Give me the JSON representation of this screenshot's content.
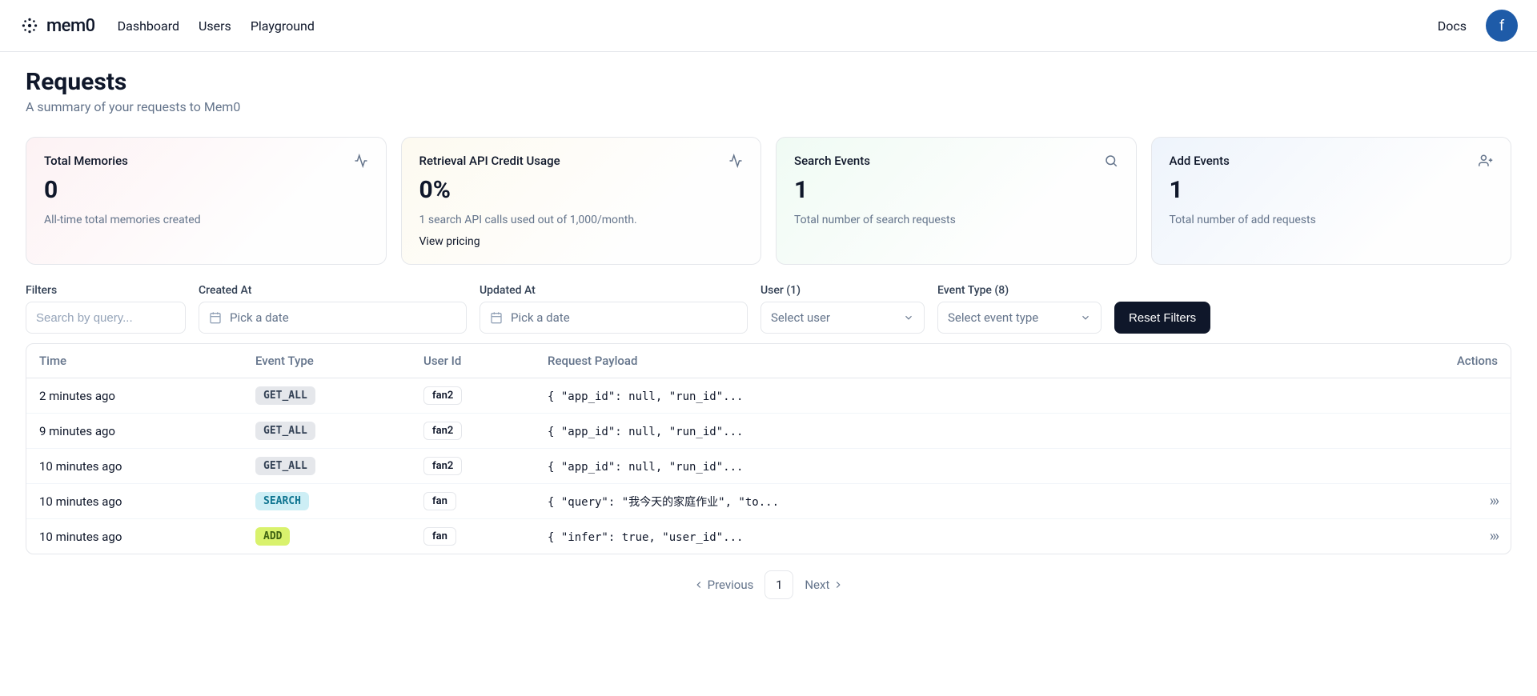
{
  "brand": "mem0",
  "nav": {
    "dashboard": "Dashboard",
    "users": "Users",
    "playground": "Playground",
    "docs": "Docs"
  },
  "avatar_initial": "f",
  "page": {
    "title": "Requests",
    "subtitle": "A summary of your requests to Mem0"
  },
  "cards": {
    "memories": {
      "title": "Total Memories",
      "value": "0",
      "desc": "All-time total memories created"
    },
    "credit": {
      "title": "Retrieval API Credit Usage",
      "value": "0%",
      "desc": "1 search API calls used out of 1,000/month.",
      "link": "View pricing"
    },
    "search": {
      "title": "Search Events",
      "value": "1",
      "desc": "Total number of search requests"
    },
    "add": {
      "title": "Add Events",
      "value": "1",
      "desc": "Total number of add requests"
    }
  },
  "filters": {
    "filters_label": "Filters",
    "search_placeholder": "Search by query...",
    "created_label": "Created At",
    "updated_label": "Updated At",
    "date_placeholder": "Pick a date",
    "user_label": "User (1)",
    "user_placeholder": "Select user",
    "event_label": "Event Type (8)",
    "event_placeholder": "Select event type",
    "reset": "Reset Filters"
  },
  "table": {
    "headers": {
      "time": "Time",
      "type": "Event Type",
      "user": "User Id",
      "payload": "Request Payload",
      "actions": "Actions"
    },
    "rows": [
      {
        "time": "2 minutes ago",
        "type": "GET_ALL",
        "badge_class": "badge-gray",
        "user": "fan2",
        "payload": "{ \"app_id\": null, \"run_id\"...",
        "has_actions": false
      },
      {
        "time": "9 minutes ago",
        "type": "GET_ALL",
        "badge_class": "badge-gray",
        "user": "fan2",
        "payload": "{ \"app_id\": null, \"run_id\"...",
        "has_actions": false
      },
      {
        "time": "10 minutes ago",
        "type": "GET_ALL",
        "badge_class": "badge-gray",
        "user": "fan2",
        "payload": "{ \"app_id\": null, \"run_id\"...",
        "has_actions": false
      },
      {
        "time": "10 minutes ago",
        "type": "SEARCH",
        "badge_class": "badge-cyan",
        "user": "fan",
        "payload": "{ \"query\": \"我今天的家庭作业\", \"to...",
        "has_actions": true
      },
      {
        "time": "10 minutes ago",
        "type": "ADD",
        "badge_class": "badge-lime",
        "user": "fan",
        "payload": "{ \"infer\": true, \"user_id\"...",
        "has_actions": true
      }
    ]
  },
  "pagination": {
    "prev": "Previous",
    "page": "1",
    "next": "Next"
  }
}
